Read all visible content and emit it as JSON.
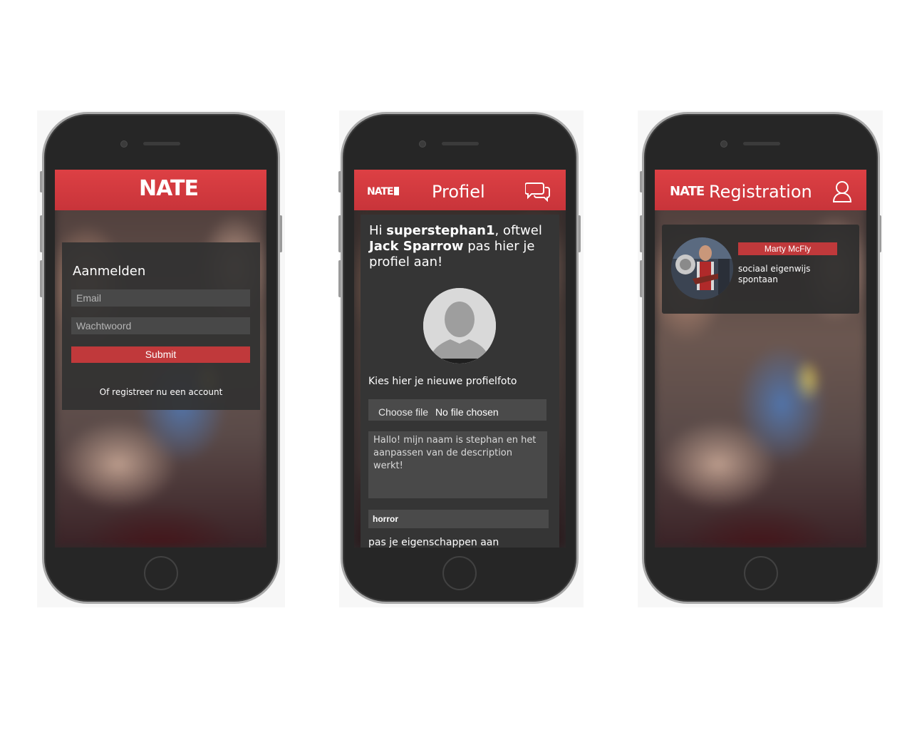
{
  "screens": {
    "login": {
      "logo": "NATE",
      "title": "Aanmelden",
      "email_placeholder": "Email",
      "password_placeholder": "Wachtwoord",
      "submit_label": "Submit",
      "register_link": "Of registreer nu een account"
    },
    "profile": {
      "logo": "NATE",
      "title": "Profiel",
      "header_icon": "chat-bubbles-icon",
      "greeting": {
        "hi": "Hi ",
        "username": "superstephan1",
        "mid": ", oftwel ",
        "name": "Jack Sparrow",
        "end": " pas hier je profiel aan!"
      },
      "avatar_icon": "default-avatar-icon",
      "choose_photo_label": "Kies hier je nieuwe profielfoto",
      "file_button": "Choose file",
      "file_status": "No file chosen",
      "description": "Hallo! mijn naam is stephan en het aanpassen van de description werkt!",
      "genre": "horror",
      "traits_label": "pas je eigenschappen aan"
    },
    "registration": {
      "logo": "NATE",
      "title": "Registration",
      "header_icon": "user-icon",
      "match": {
        "name": "Marty McFly",
        "traits": [
          "sociaal eigenwijs",
          "spontaan"
        ]
      }
    }
  },
  "colors": {
    "accent": "#d63b40",
    "card": "#353535",
    "page_bg": "#ffffff"
  }
}
